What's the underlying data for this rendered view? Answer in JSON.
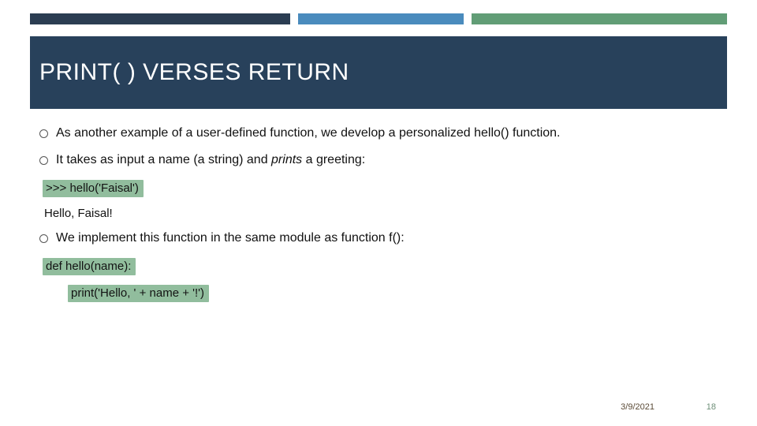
{
  "title": "PRINT( ) VERSES RETURN",
  "bullets": {
    "b1": "As another example of a user-defined function, we develop a personalized hello() function.",
    "b2_pre": "It takes as input a name (a string) and ",
    "b2_em": "prints",
    "b2_post": " a greeting:",
    "b3": "We implement this function in the same module as function f():"
  },
  "code": {
    "call": ">>> hello('Faisal')",
    "output": "Hello, Faisal!",
    "def": "def hello(name):",
    "body": "print('Hello, ' + name + '!')"
  },
  "footer": {
    "date": "3/9/2021",
    "page": "18"
  }
}
